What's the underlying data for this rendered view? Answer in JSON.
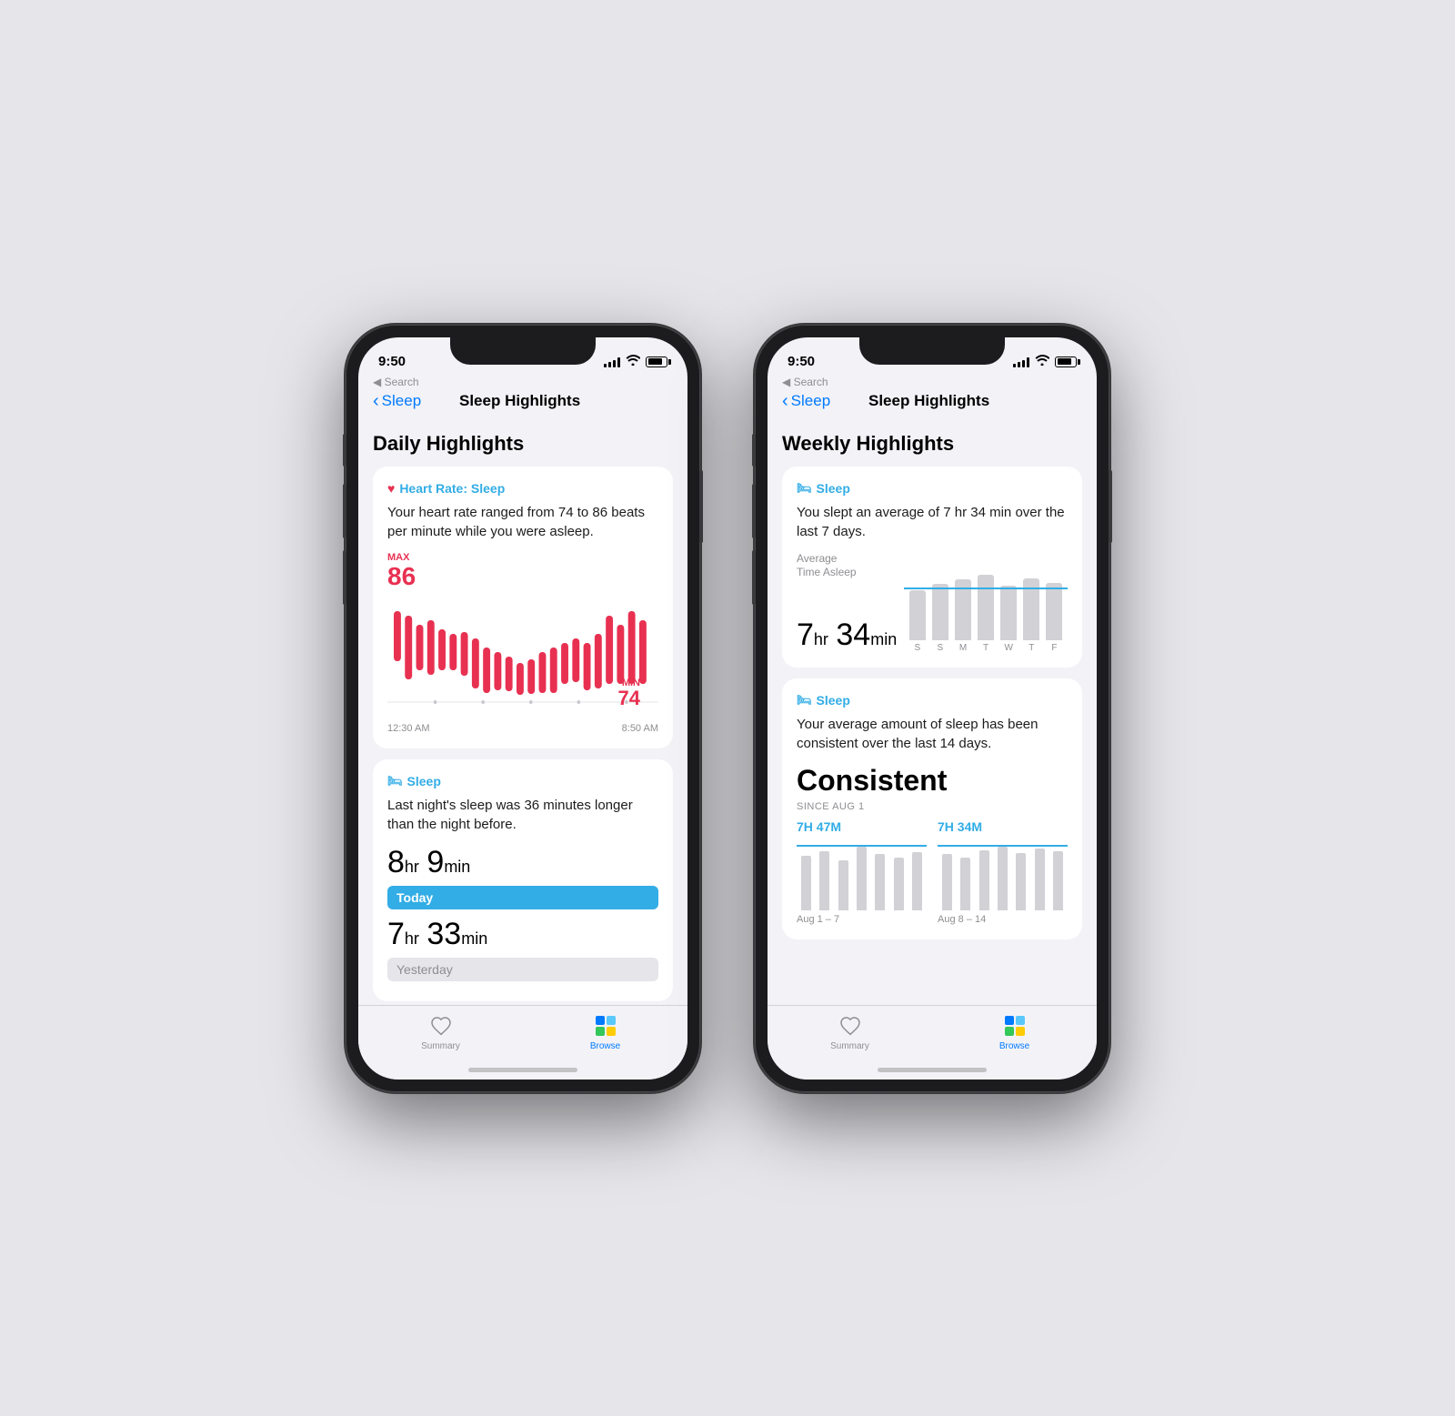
{
  "phone1": {
    "status": {
      "time": "9:50",
      "has_location": true
    },
    "nav": {
      "back_label": "Sleep",
      "title": "Sleep Highlights"
    },
    "daily": {
      "section_title": "Daily Highlights",
      "card1": {
        "header": "Heart Rate: Sleep",
        "body": "Your heart rate ranged from 74 to 86 beats per minute while you were asleep.",
        "max_label": "MAX",
        "max_val": "86",
        "min_label": "MIN",
        "min_val": "74",
        "time_start": "12:30 AM",
        "time_end": "8:50 AM",
        "bars": [
          60,
          90,
          75,
          80,
          65,
          55,
          70,
          60,
          75,
          85,
          65,
          55,
          65,
          75,
          80,
          70,
          85,
          60,
          70,
          80
        ]
      },
      "card2": {
        "header": "Sleep",
        "body": "Last night's sleep was 36 minutes longer than the night before.",
        "today_hr": "8",
        "today_min": "9",
        "today_label": "Today",
        "yesterday_hr": "7",
        "yesterday_min": "33",
        "yesterday_label": "Yesterday"
      }
    },
    "tabs": {
      "summary_label": "Summary",
      "browse_label": "Browse"
    }
  },
  "phone2": {
    "status": {
      "time": "9:50"
    },
    "nav": {
      "back_label": "Sleep",
      "title": "Sleep Highlights"
    },
    "weekly": {
      "section_title": "Weekly Highlights",
      "card1": {
        "header": "Sleep",
        "body": "You slept an average of 7 hr 34 min over the last 7 days.",
        "avg_label1": "Average",
        "avg_label2": "Time Asleep",
        "avg_hr": "7",
        "avg_min": "34",
        "bars": [
          70,
          80,
          85,
          90,
          75,
          88,
          80
        ],
        "bar_labels": [
          "S",
          "S",
          "M",
          "T",
          "W",
          "T",
          "F"
        ]
      },
      "card2": {
        "header": "Sleep",
        "body": "Your average amount of sleep has been consistent over the last 14 days.",
        "consistent_label": "Consistent",
        "since_label": "SINCE AUG 1",
        "period1": {
          "avg": "7H 47M",
          "date": "Aug 1 – 7",
          "bars": [
            70,
            75,
            65,
            80,
            72,
            68,
            74
          ]
        },
        "period2": {
          "avg": "7H 34M",
          "date": "Aug 8 – 14",
          "bars": [
            72,
            68,
            76,
            80,
            73,
            78,
            75
          ]
        }
      }
    },
    "tabs": {
      "summary_label": "Summary",
      "browse_label": "Browse"
    }
  }
}
